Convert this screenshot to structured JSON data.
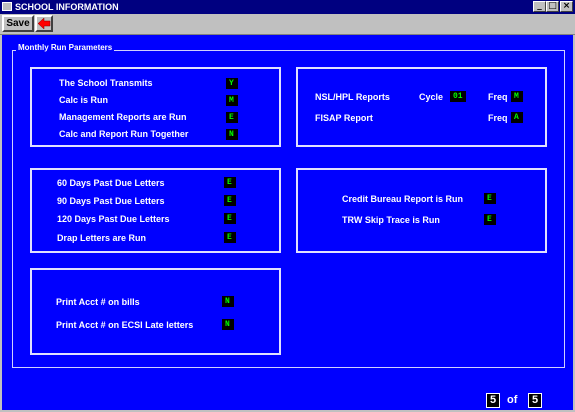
{
  "window": {
    "title": "SCHOOL INFORMATION",
    "minimize": "_",
    "maximize": "□",
    "close": "×"
  },
  "toolbar": {
    "save_label": "Save"
  },
  "group_title": "Monthly Run Parameters",
  "panel1": {
    "school_transmits_label": "The School Transmits",
    "school_transmits_value": "Y",
    "calc_is_run_label": "Calc is Run",
    "calc_is_run_value": "M",
    "mgmt_reports_label": "Management Reports are Run",
    "mgmt_reports_value": "E",
    "calc_report_together_label": "Calc and Report Run Together",
    "calc_report_together_value": "N"
  },
  "panel2": {
    "nsl_label": "NSL/HPL Reports",
    "cycle_label": "Cycle",
    "cycle_value": "01",
    "freq_label": "Freq",
    "nsl_freq_value": "M",
    "fisap_label": "FISAP Report",
    "fisap_freq_value": "A"
  },
  "panel3": {
    "days60_label": "60 Days Past Due Letters",
    "days60_value": "E",
    "days90_label": "90 Days Past Due Letters",
    "days90_value": "E",
    "days120_label": "120 Days Past Due Letters",
    "days120_value": "E",
    "drap_label": "Drap Letters are Run",
    "drap_value": "E"
  },
  "panel4": {
    "credit_bureau_label": "Credit Bureau Report is Run",
    "credit_bureau_value": "E",
    "trw_label": "TRW Skip Trace is Run",
    "trw_value": "E"
  },
  "panel5": {
    "print_acct_bills_label": "Print Acct # on bills",
    "print_acct_bills_value": "N",
    "print_acct_ecsi_label": "Print Acct # on ECSI Late letters",
    "print_acct_ecsi_value": "N"
  },
  "pager": {
    "current": "5",
    "of_label": "of",
    "total": "5"
  }
}
